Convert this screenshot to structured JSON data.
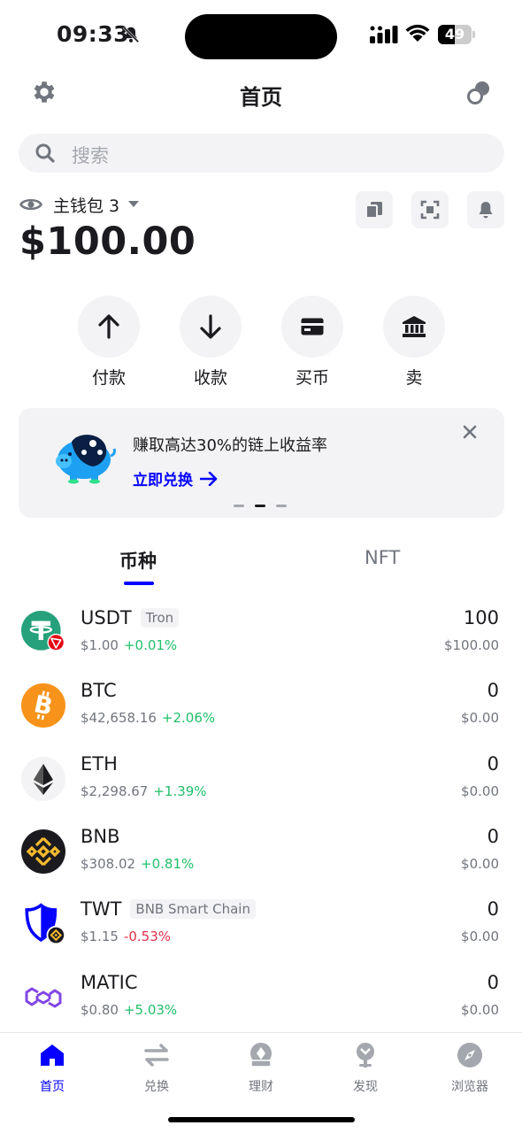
{
  "status_bar": {
    "time": "09:33",
    "battery": "49",
    "battery_level": 0.49
  },
  "header": {
    "title": "首页",
    "settings_icon": "gear-icon",
    "wallets_icon": "wallets-icon"
  },
  "search": {
    "placeholder": "搜索"
  },
  "wallet": {
    "name": "主钱包 3",
    "balance": "$100.00",
    "quick_actions": [
      "copy-icon",
      "scan-icon",
      "bell-icon"
    ]
  },
  "actions": [
    {
      "label": "付款",
      "icon": "arrow-up-icon"
    },
    {
      "label": "收款",
      "icon": "arrow-down-icon"
    },
    {
      "label": "买币",
      "icon": "card-icon"
    },
    {
      "label": "卖",
      "icon": "bank-icon"
    }
  ],
  "banner": {
    "title": "赚取高达30%的链上收益率",
    "link": "立即兑换",
    "pages": 3,
    "active_page": 2
  },
  "tabs": [
    {
      "label": "币种",
      "active": true
    },
    {
      "label": "NFT",
      "active": false
    }
  ],
  "assets": [
    {
      "symbol": "USDT",
      "chain": "Tron",
      "price": "$1.00",
      "change": "+0.01%",
      "direction": "up",
      "quantity": "100",
      "value": "$100.00",
      "logo": "tether-icon",
      "logo_color": "#26a17b"
    },
    {
      "symbol": "BTC",
      "chain": "",
      "price": "$42,658.16",
      "change": "+2.06%",
      "direction": "up",
      "quantity": "0",
      "value": "$0.00",
      "logo": "bitcoin-icon",
      "logo_color": "#f7931a"
    },
    {
      "symbol": "ETH",
      "chain": "",
      "price": "$2,298.67",
      "change": "+1.39%",
      "direction": "up",
      "quantity": "0",
      "value": "$0.00",
      "logo": "ethereum-icon",
      "logo_color": "#f3f3f5"
    },
    {
      "symbol": "BNB",
      "chain": "",
      "price": "$308.02",
      "change": "+0.81%",
      "direction": "up",
      "quantity": "0",
      "value": "$0.00",
      "logo": "bnb-icon",
      "logo_color": "#f3ba2f"
    },
    {
      "symbol": "TWT",
      "chain": "BNB Smart Chain",
      "price": "$1.15",
      "change": "-0.53%",
      "direction": "down",
      "quantity": "0",
      "value": "$0.00",
      "logo": "trust-shield-icon",
      "logo_color": "#0500ff"
    },
    {
      "symbol": "MATIC",
      "chain": "",
      "price": "$0.80",
      "change": "+5.03%",
      "direction": "up",
      "quantity": "0",
      "value": "$0.00",
      "logo": "polygon-icon",
      "logo_color": "#8247e5"
    }
  ],
  "bottom_nav": [
    {
      "label": "首页",
      "icon": "home-icon",
      "active": true
    },
    {
      "label": "兑换",
      "icon": "swap-icon",
      "active": false
    },
    {
      "label": "理财",
      "icon": "earn-icon",
      "active": false
    },
    {
      "label": "发现",
      "icon": "discover-icon",
      "active": false
    },
    {
      "label": "浏览器",
      "icon": "compass-icon",
      "active": false
    }
  ],
  "colors": {
    "accent": "#0500ff",
    "positive": "#20bf6b",
    "negative": "#e0314b",
    "muted": "#71757d",
    "surface": "#f3f3f5"
  }
}
